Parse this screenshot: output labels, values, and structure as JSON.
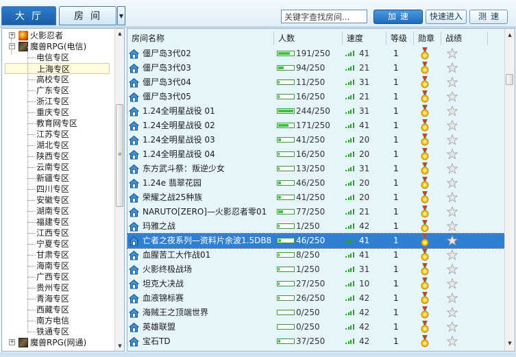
{
  "tabs": {
    "lobby": "大厅",
    "room": "房间",
    "dropdown_icon": "triangle-down-icon"
  },
  "toolbar": {
    "search_value": "关键字查找房间...",
    "accelerate_label": "加速",
    "quick_join_label": "快速进入",
    "speed_test_label": "测速"
  },
  "colors": {
    "accent": "#2f80d3",
    "lobby_tab": "#1f6bbd",
    "row_bg": "#e6f5fa",
    "signal_green": "#2aa02a"
  },
  "tree": {
    "nodes": [
      {
        "label": "火影忍者",
        "level": 0,
        "expander": "+",
        "icon": "fire-game-icon"
      },
      {
        "label": "魔兽RPG(电信)",
        "level": 0,
        "expander": "−",
        "icon": "warcraft-icon"
      },
      {
        "label": "电信专区",
        "level": 1
      },
      {
        "label": "上海专区",
        "level": 1,
        "selected": true
      },
      {
        "label": "高校专区",
        "level": 1
      },
      {
        "label": "广东专区",
        "level": 1
      },
      {
        "label": "浙江专区",
        "level": 1
      },
      {
        "label": "重庆专区",
        "level": 1
      },
      {
        "label": "教育网专区",
        "level": 1
      },
      {
        "label": "江苏专区",
        "level": 1
      },
      {
        "label": "湖北专区",
        "level": 1
      },
      {
        "label": "陕西专区",
        "level": 1
      },
      {
        "label": "云南专区",
        "level": 1
      },
      {
        "label": "新疆专区",
        "level": 1
      },
      {
        "label": "四川专区",
        "level": 1
      },
      {
        "label": "安徽专区",
        "level": 1
      },
      {
        "label": "湖南专区",
        "level": 1
      },
      {
        "label": "福建专区",
        "level": 1
      },
      {
        "label": "江西专区",
        "level": 1
      },
      {
        "label": "宁夏专区",
        "level": 1
      },
      {
        "label": "甘肃专区",
        "level": 1
      },
      {
        "label": "海南专区",
        "level": 1
      },
      {
        "label": "广西专区",
        "level": 1
      },
      {
        "label": "贵州专区",
        "level": 1
      },
      {
        "label": "青海专区",
        "level": 1
      },
      {
        "label": "西藏专区",
        "level": 1
      },
      {
        "label": "南方电信",
        "level": 1
      },
      {
        "label": "铁通专区",
        "level": 1
      },
      {
        "label": "魔兽RPG(网通)",
        "level": 0,
        "expander": "+",
        "icon": "warcraft-icon"
      }
    ]
  },
  "table": {
    "columns": [
      "房间名称",
      "人数",
      "速度",
      "等级",
      "勋章",
      "战绩"
    ],
    "rows": [
      {
        "name": "僵尸岛3代02",
        "players": "191/250",
        "fill": 0.76,
        "speed": "41",
        "signal": 4,
        "level": "1"
      },
      {
        "name": "僵尸岛3代03",
        "players": "94/250",
        "fill": 0.38,
        "speed": "21",
        "signal": 4,
        "level": "1"
      },
      {
        "name": "僵尸岛3代04",
        "players": "11/250",
        "fill": 0.04,
        "speed": "31",
        "signal": 4,
        "level": "1"
      },
      {
        "name": "僵尸岛3代05",
        "players": "16/250",
        "fill": 0.06,
        "speed": "21",
        "signal": 4,
        "level": "1"
      },
      {
        "name": "1.24全明星战役 01",
        "players": "244/250",
        "fill": 0.98,
        "speed": "31",
        "signal": 4,
        "level": "1"
      },
      {
        "name": "1.24全明星战役 02",
        "players": "171/250",
        "fill": 0.68,
        "speed": "41",
        "signal": 4,
        "level": "1"
      },
      {
        "name": "1.24全明星战役 03",
        "players": "41/250",
        "fill": 0.16,
        "speed": "20",
        "signal": 4,
        "level": "1"
      },
      {
        "name": "1.24全明星战役 04",
        "players": "16/250",
        "fill": 0.06,
        "speed": "20",
        "signal": 4,
        "level": "1"
      },
      {
        "name": "东方武斗祭：叛逆少女",
        "players": "13/250",
        "fill": 0.05,
        "speed": "31",
        "signal": 4,
        "level": "1"
      },
      {
        "name": "1.24e 翡翠花园",
        "players": "46/250",
        "fill": 0.18,
        "speed": "20",
        "signal": 4,
        "level": "1"
      },
      {
        "name": "荣耀之战25种族",
        "players": "41/250",
        "fill": 0.16,
        "speed": "20",
        "signal": 4,
        "level": "1"
      },
      {
        "name": "NARUTO[ZERO]—火影忍者零01",
        "players": "77/250",
        "fill": 0.31,
        "speed": "21",
        "signal": 4,
        "level": "1"
      },
      {
        "name": "玛雅之战",
        "players": "1/250",
        "fill": 0.004,
        "speed": "42",
        "signal": 4,
        "level": "1"
      },
      {
        "name": "亡者之夜系列—资料片余波1.5DB8",
        "players": "46/250",
        "fill": 0.18,
        "speed": "41",
        "signal": 4,
        "level": "1",
        "selected": true
      },
      {
        "name": "血腥苦工大作战01",
        "players": "8/250",
        "fill": 0.03,
        "speed": "41",
        "signal": 4,
        "level": "1"
      },
      {
        "name": "火影终极战场",
        "players": "1/250",
        "fill": 0.004,
        "speed": "31",
        "signal": 4,
        "level": "1"
      },
      {
        "name": "坦克大决战",
        "players": "27/250",
        "fill": 0.11,
        "speed": "10",
        "signal": 4,
        "level": "1"
      },
      {
        "name": "血液锦标赛",
        "players": "26/250",
        "fill": 0.1,
        "speed": "42",
        "signal": 4,
        "level": "1"
      },
      {
        "name": "海贼王之顶端世界",
        "players": "0/250",
        "fill": 0,
        "speed": "42",
        "signal": 4,
        "level": "1"
      },
      {
        "name": "英雄联盟",
        "players": "0/250",
        "fill": 0,
        "speed": "42",
        "signal": 4,
        "level": "1"
      },
      {
        "name": "宝石TD",
        "players": "37/250",
        "fill": 0.15,
        "speed": "42",
        "signal": 4,
        "level": "1"
      }
    ]
  }
}
